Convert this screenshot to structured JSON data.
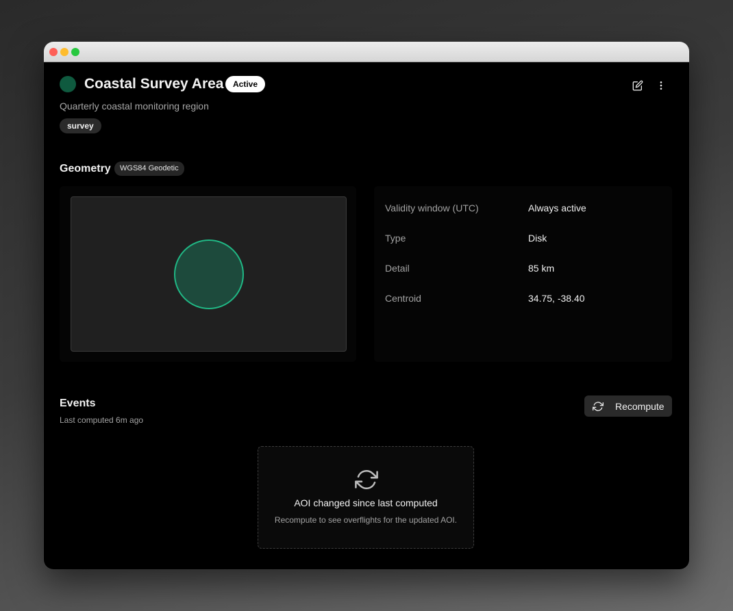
{
  "aoi": {
    "title": "Coastal Survey Area",
    "status": "Active",
    "description": "Quarterly coastal monitoring region",
    "tags": [
      "survey"
    ],
    "color": "#0f5a3f"
  },
  "geometry": {
    "heading": "Geometry",
    "crs": "WGS84 Geodetic",
    "properties": [
      {
        "label": "Validity window (UTC)",
        "value": "Always active"
      },
      {
        "label": "Type",
        "value": "Disk"
      },
      {
        "label": "Detail",
        "value": "85 km"
      },
      {
        "label": "Centroid",
        "value": "34.75, -38.40"
      }
    ]
  },
  "events": {
    "heading": "Events",
    "last_computed": "Last computed 6m ago",
    "recompute_label": "Recompute",
    "empty_title": "AOI changed since last computed",
    "empty_description": "Recompute to see overflights for the updated AOI."
  },
  "icons": {
    "edit": "edit-icon",
    "more": "more-vertical-icon",
    "refresh": "refresh-icon"
  },
  "colors": {
    "accent": "#20b885",
    "aoi_fill": "#1d4a3c"
  }
}
